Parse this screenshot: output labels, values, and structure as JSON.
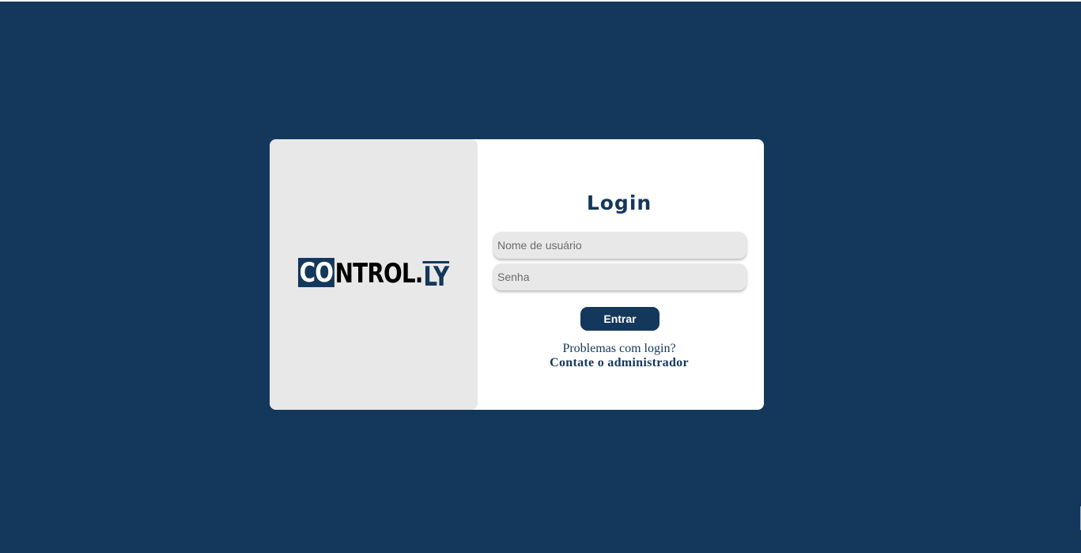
{
  "brand": {
    "logo_part1": "CO",
    "logo_part2": "NTROL.",
    "logo_part3": "LY"
  },
  "login": {
    "title": "Login",
    "username_placeholder": "Nome de usuário",
    "password_placeholder": "Senha",
    "submit_label": "Entrar",
    "help_text": "Problemas com login?",
    "help_link": "Contate o administrador"
  },
  "colors": {
    "background": "#14375c",
    "panel": "#e8e8e8",
    "accent": "#14375c"
  }
}
